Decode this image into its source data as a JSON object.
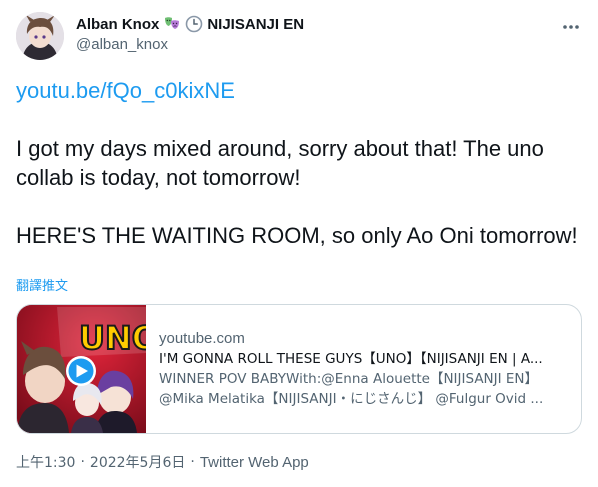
{
  "author": {
    "display_name": "Alban Knox",
    "badge_icons": [
      "theater-masks-icon",
      "clock-icon"
    ],
    "affiliation": "NIJISANJI EN",
    "handle": "@alban_knox"
  },
  "tweet": {
    "link_text": "youtu.be/fQo_c0kixNE",
    "paragraph_1": "I got my days mixed around, sorry about that! The uno collab is today, not tomorrow!",
    "paragraph_2": "HERE'S THE WAITING ROOM, so only Ao Oni tomorrow!",
    "translate_label": "翻譯推文"
  },
  "card": {
    "domain": "youtube.com",
    "title": "I'M GONNA ROLL THESE GUYS【UNO】【NIJISANJI EN | A...",
    "description_line_1": "WINNER POV BABYWith:@Enna Alouette【NIJISANJI EN】",
    "description_line_2": "@Mika Melatika【NIJISANJI・にじさんじ】 @Fulgur Ovid ...",
    "thumbnail_text": "UNO"
  },
  "meta": {
    "time": "上午1:30",
    "date": "2022年5月6日",
    "source": "Twitter Web App",
    "separator": "·"
  },
  "colors": {
    "link": "#1d9bf0",
    "text": "#0f1419",
    "secondary": "#536471",
    "border": "#cfd9de"
  }
}
